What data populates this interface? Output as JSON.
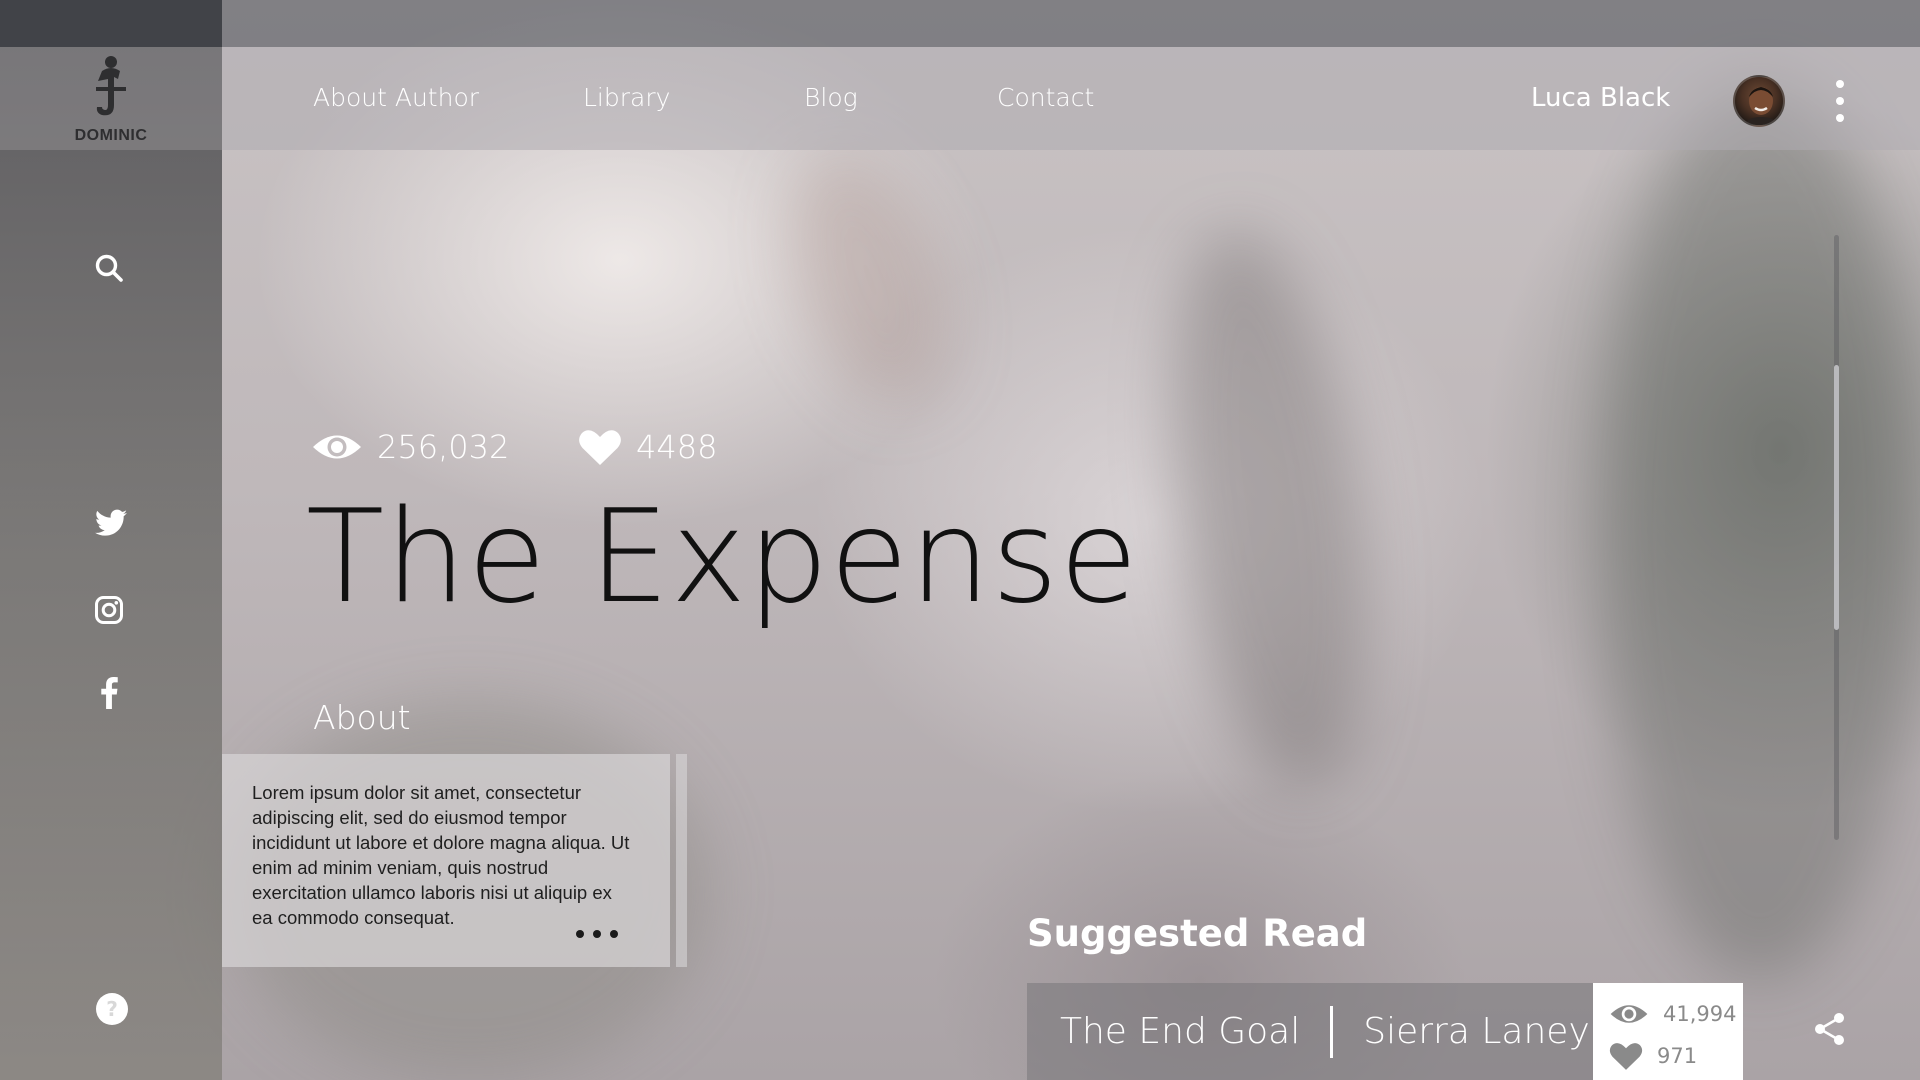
{
  "brand": {
    "logo_text": "DOMINIC"
  },
  "nav": {
    "items": [
      {
        "label": "About Author"
      },
      {
        "label": "Library"
      },
      {
        "label": "Blog"
      },
      {
        "label": "Contact"
      }
    ]
  },
  "user": {
    "name": "Luca Black",
    "avatar_icon": "avatar-photo"
  },
  "sidebar": {
    "icons": [
      "search-icon",
      "twitter-icon",
      "instagram-icon",
      "facebook-icon",
      "help-icon"
    ]
  },
  "book": {
    "views": "256,032",
    "likes": "4488",
    "title": "The Expense",
    "about_label": "About",
    "about_text": "Lorem ipsum dolor sit amet, consectetur adipiscing elit, sed do eiusmod tempor incididunt ut labore et dolore magna aliqua. Ut enim ad minim veniam, quis nostrud exercitation ullamco laboris nisi ut aliquip ex ea commodo consequat."
  },
  "suggested": {
    "heading": "Suggested Read",
    "title": "The End Goal",
    "author": "Sierra Laney",
    "views": "41,994",
    "likes": "971"
  },
  "colors": {
    "text_light": "#ffffff",
    "title_dark": "#111111",
    "stat_grey": "#8a8a8a"
  }
}
